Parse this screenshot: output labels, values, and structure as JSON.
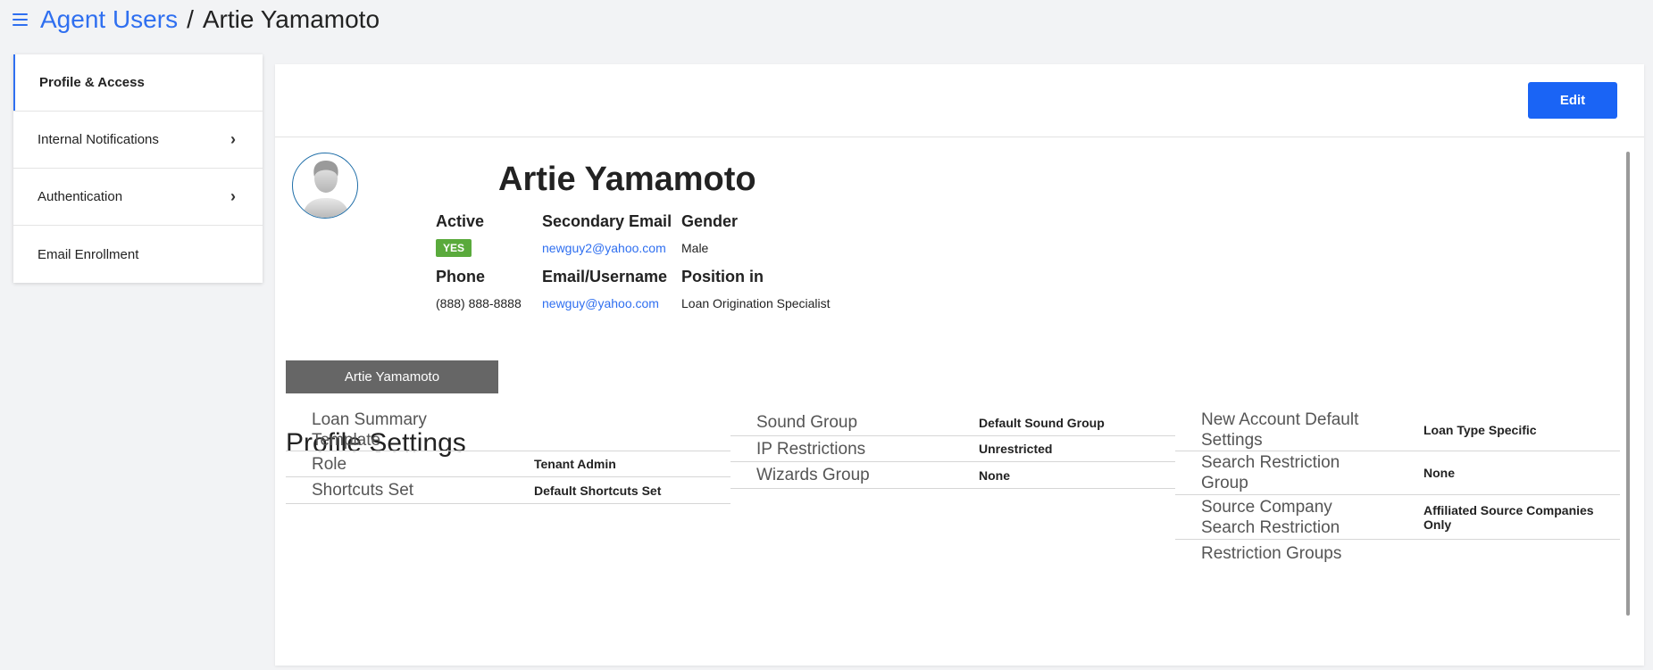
{
  "breadcrumb": {
    "parent": "Agent Users",
    "separator": "/",
    "current": "Artie Yamamoto"
  },
  "sidebar": {
    "items": [
      {
        "label": "Profile & Access"
      },
      {
        "label": "Internal Notifications"
      },
      {
        "label": "Authentication"
      },
      {
        "label": "Email Enrollment"
      }
    ]
  },
  "toolbar": {
    "edit_label": "Edit"
  },
  "profile": {
    "name": "Artie Yamamoto",
    "avatar_caption": "Artie Yamamoto",
    "fields": {
      "active": {
        "label": "Active",
        "value": "YES"
      },
      "secondary_email": {
        "label": "Secondary Email",
        "value": "newguy2@yahoo.com"
      },
      "gender": {
        "label": "Gender",
        "value": "Male"
      },
      "phone": {
        "label": "Phone",
        "value": "(888) 888-8888"
      },
      "email_username": {
        "label": "Email/Username",
        "value": "newguy@yahoo.com"
      },
      "position": {
        "label": "Position in",
        "value": "Loan Origination Specialist"
      }
    }
  },
  "settings": {
    "title": "Profile Settings",
    "col1": [
      {
        "label": "Loan Summary Template",
        "value": ""
      },
      {
        "label": "Role",
        "value": "Tenant Admin"
      },
      {
        "label": "Shortcuts Set",
        "value": "Default Shortcuts Set"
      }
    ],
    "col2": [
      {
        "label": "Sound Group",
        "value": "Default Sound Group"
      },
      {
        "label": "IP Restrictions",
        "value": "Unrestricted"
      },
      {
        "label": "Wizards Group",
        "value": "None"
      }
    ],
    "col3": [
      {
        "label": "New Account Default Settings",
        "value": "Loan Type Specific"
      },
      {
        "label": "Search Restriction Group",
        "value": "None"
      },
      {
        "label": "Source Company Search Restriction",
        "value": "Affiliated Source Companies Only"
      },
      {
        "label": "Restriction Groups",
        "value": ""
      }
    ]
  },
  "colors": {
    "accent": "#2f6ff0",
    "button": "#1a64f5",
    "active_badge": "#5aaa3c",
    "name_plate": "#666666"
  }
}
